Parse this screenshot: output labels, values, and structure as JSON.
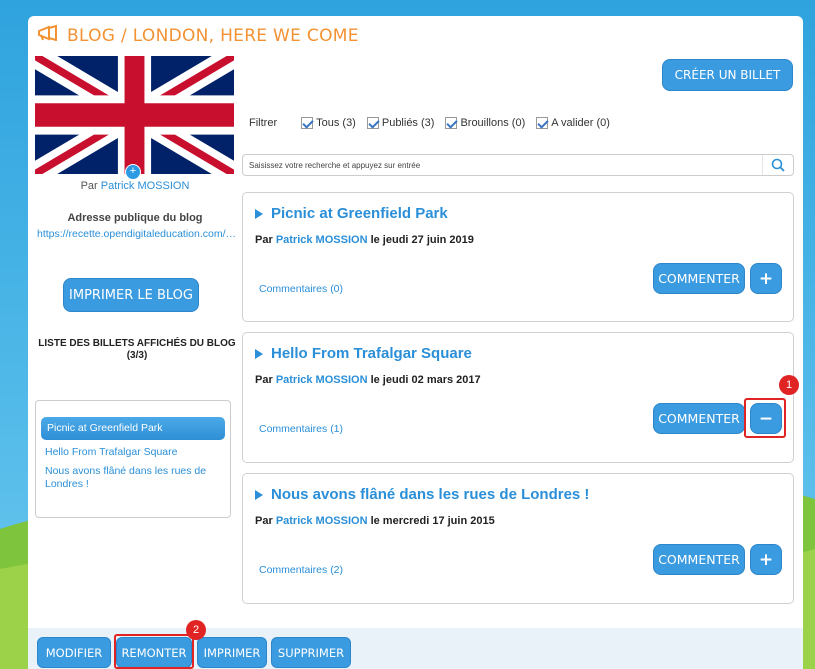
{
  "blog": {
    "title": "BLOG / LONDON, HERE WE COME",
    "create_label": "CRÉER UN BILLET",
    "author_prefix": "Par",
    "author_name": "Patrick MOSSION",
    "address_title": "Adresse publique du blog",
    "address_url": "https://recette.opendigitaleducation.com/blog/pub/london-here-we-come",
    "print_label": "IMPRIMER LE BLOG",
    "list_title": "LISTE DES BILLETS AFFICHÉS DU BLOG (3/3)"
  },
  "filters": {
    "label": "Filtrer",
    "items": [
      {
        "label": "Tous (3)",
        "checked": true
      },
      {
        "label": "Publiés (3)",
        "checked": true
      },
      {
        "label": "Brouillons (0)",
        "checked": true
      },
      {
        "label": "A valider (0)",
        "checked": true
      }
    ]
  },
  "search": {
    "placeholder": "Saisissez votre recherche et appuyez sur entrée"
  },
  "sidebar_posts": [
    {
      "label": "Picnic at Greenfield Park",
      "active": true
    },
    {
      "label": "Hello From Trafalgar Square",
      "active": false
    },
    {
      "label": "Nous avons flâné dans les rues de Londres !",
      "active": false
    }
  ],
  "posts": [
    {
      "title": "Picnic at Greenfield Park",
      "by": "Par",
      "author": "Patrick MOSSION",
      "date": "le jeudi 27 juin 2019",
      "comments": "Commentaires (0)",
      "comment_label": "COMMENTER",
      "toggle": "+"
    },
    {
      "title": "Hello From Trafalgar Square",
      "by": "Par",
      "author": "Patrick MOSSION",
      "date": "le jeudi 02 mars 2017",
      "comments": "Commentaires (1)",
      "comment_label": "COMMENTER",
      "toggle": "−"
    },
    {
      "title": "Nous avons flâné dans les rues de Londres !",
      "by": "Par",
      "author": "Patrick MOSSION",
      "date": "le mercredi 17 juin 2015",
      "comments": "Commentaires (2)",
      "comment_label": "COMMENTER",
      "toggle": "+"
    }
  ],
  "footer": {
    "modify": "MODIFIER",
    "move_up": "REMONTER",
    "print": "IMPRIMER",
    "delete": "SUPPRIMER"
  },
  "annotations": {
    "badge_1": "1",
    "badge_2": "2"
  },
  "colors": {
    "accent": "#3b9be0",
    "title_orange": "#f39233",
    "link_blue": "#2a8fd8",
    "highlight_red": "#e02424"
  }
}
